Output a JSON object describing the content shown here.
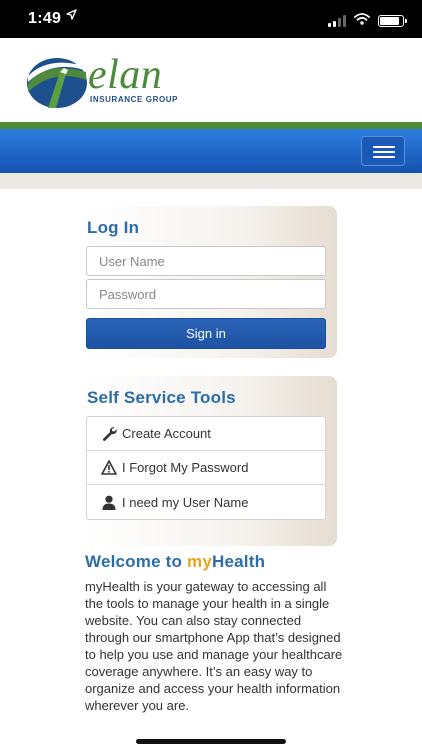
{
  "status_bar": {
    "time": "1:49",
    "location_icon": "location-arrow-icon",
    "signal_bars_active": 2,
    "signal_bars_total": 4,
    "battery_level": 0.85
  },
  "brand": {
    "name": "elan",
    "subtitle": "INSURANCE GROUP",
    "colors": {
      "green": "#4f8a3c",
      "blue": "#1552b0",
      "accent_gold": "#e7a41c",
      "title_blue": "#2a6da8"
    }
  },
  "nav": {
    "menu_icon": "hamburger-menu-icon"
  },
  "login": {
    "title": "Log In",
    "username_placeholder": "User Name",
    "password_placeholder": "Password",
    "username_value": "",
    "password_value": "",
    "sign_in_label": "Sign in"
  },
  "self_service": {
    "title": "Self Service Tools",
    "items": [
      {
        "label": "Create Account",
        "icon": "wrench-icon"
      },
      {
        "label": "I Forgot My Password",
        "icon": "warning-icon"
      },
      {
        "label": "I need my User Name",
        "icon": "user-icon"
      }
    ]
  },
  "welcome": {
    "title_prefix": "Welcome to ",
    "title_highlight": "my",
    "title_suffix": "Health",
    "body": "myHealth is your gateway to accessing all the tools to manage your health in a single website. You can also stay connected through our smartphone App that’s designed to help you use and manage your healthcare coverage anywhere. It’s an easy way to organize and access your health information wherever you are."
  }
}
